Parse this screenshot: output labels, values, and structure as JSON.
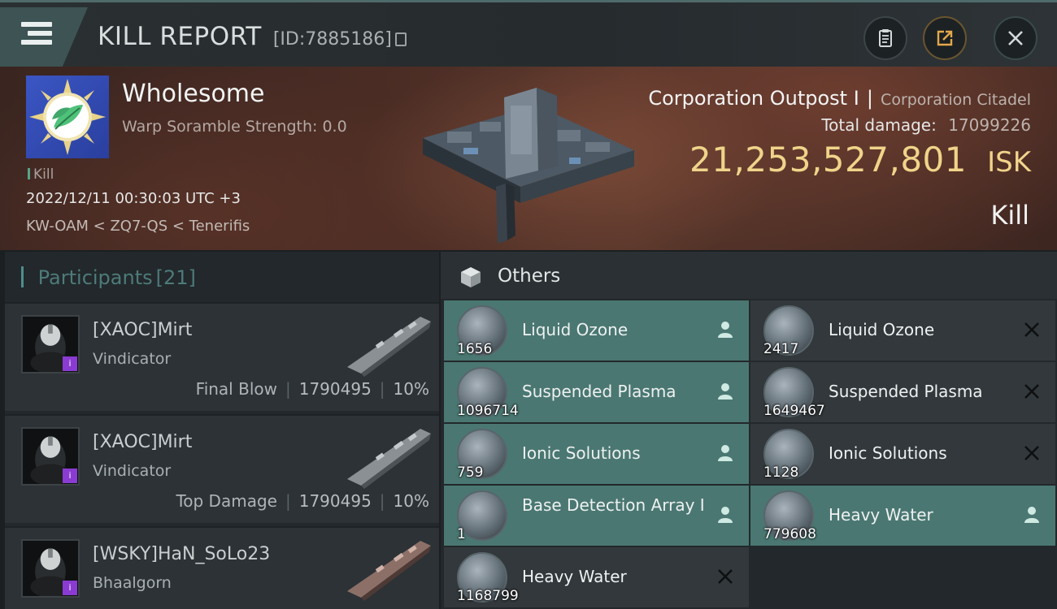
{
  "header": {
    "title": "KILL REPORT",
    "report_id": "[ID:7885186]"
  },
  "victim": {
    "name": "Wholesome",
    "warp_scramble": "Warp Soramble Strength: 0.0",
    "kill_tag": "Kill",
    "timestamp": "2022/12/11 00:30:03 UTC +3",
    "location": "KW-OAM < ZQ7-QS < Tenerifis"
  },
  "target": {
    "name": "Corporation Outpost I",
    "separator": "|",
    "type": "Corporation Citadel",
    "damage_label": "Total damage:",
    "damage_value": "17099226",
    "isk_value": "21,253,527,801",
    "isk_unit": "ISK",
    "result": "Kill"
  },
  "participants": {
    "title": "Participants",
    "count": "[21]",
    "list": [
      {
        "name": "[XAOC]Mirt",
        "ship": "Vindicator",
        "role": "Final Blow",
        "damage": "1790495",
        "percent": "10%"
      },
      {
        "name": "[XAOC]Mirt",
        "ship": "Vindicator",
        "role": "Top Damage",
        "damage": "1790495",
        "percent": "10%"
      },
      {
        "name": "[WSKY]HaN_SoLo23",
        "ship": "Bhaalgorn",
        "role": "",
        "damage": "",
        "percent": ""
      }
    ]
  },
  "others": {
    "title": "Others",
    "items": [
      {
        "name": "Liquid Ozone",
        "qty": "1656",
        "status": "dropped",
        "icon": "fuel-icon"
      },
      {
        "name": "Liquid Ozone",
        "qty": "2417",
        "status": "destroyed",
        "icon": "fuel-icon"
      },
      {
        "name": "Suspended Plasma",
        "qty": "1096714",
        "status": "dropped",
        "icon": "canister-icon"
      },
      {
        "name": "Suspended Plasma",
        "qty": "1649467",
        "status": "destroyed",
        "icon": "canister-icon"
      },
      {
        "name": "Ionic Solutions",
        "qty": "759",
        "status": "dropped",
        "icon": "canister-icon"
      },
      {
        "name": "Ionic Solutions",
        "qty": "1128",
        "status": "destroyed",
        "icon": "canister-icon"
      },
      {
        "name": "Base Detection Array I",
        "qty": "1",
        "status": "dropped",
        "icon": "module-icon"
      },
      {
        "name": "Heavy Water",
        "qty": "779608",
        "status": "dropped",
        "icon": "coil-icon"
      },
      {
        "name": "Heavy Water",
        "qty": "1168799",
        "status": "destroyed",
        "icon": "coil-icon"
      }
    ]
  },
  "colors": {
    "dropped_bg": "#4a7772",
    "destroyed_bg": "#32383b",
    "isk_gold": "#f0d48a",
    "accent_teal": "#4f8c8c"
  }
}
